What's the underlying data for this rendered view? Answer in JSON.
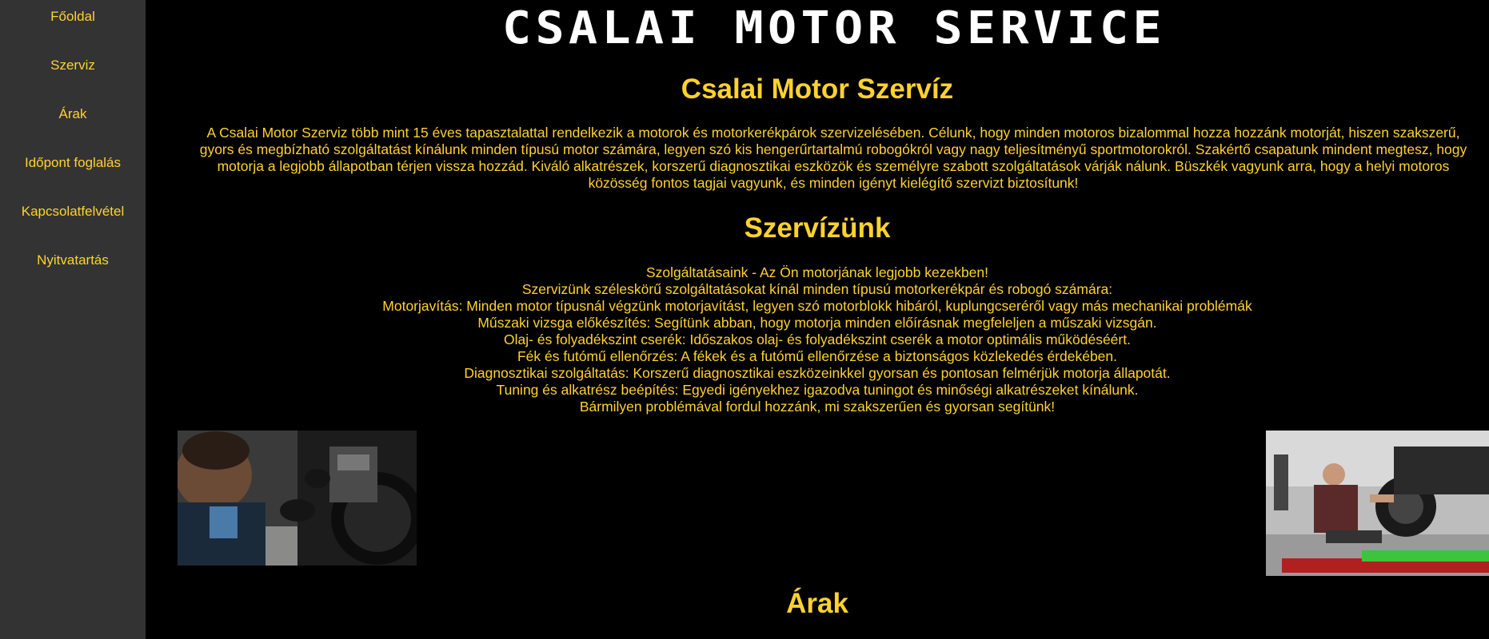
{
  "sidebar": {
    "items": [
      {
        "label": "Főoldal"
      },
      {
        "label": "Szerviz"
      },
      {
        "label": "Árak"
      },
      {
        "label": "Időpont foglalás"
      },
      {
        "label": "Kapcsolatfelvétel"
      },
      {
        "label": "Nyitvatartás"
      }
    ]
  },
  "header": {
    "logo_text": "CSALAI MOTOR SERVICE"
  },
  "main": {
    "title": "Csalai Motor Szervíz",
    "intro_lines": [
      "A Csalai Motor Szerviz több mint 15 éves tapasztalattal rendelkezik a motorok és motorkerékpárok szervizelésében. Célunk, hogy minden motoros bizalommal hozza hozzánk motorját, hiszen szakszerű,",
      "gyors és megbízható szolgáltatást kínálunk minden típusú motor számára, legyen szó kis hengerűrtartalmú robogókról vagy nagy teljesítményű sportmotorokról. Szakértő csapatunk mindent megtesz, hogy",
      "motorja a legjobb állapotban térjen vissza hozzád. Kiváló alkatrészek, korszerű diagnosztikai eszközök és személyre szabott szolgáltatások várják nálunk. Büszkék vagyunk arra, hogy a helyi motoros",
      "közösség fontos tagjai vagyunk, és minden igényt kielégítő szervizt biztosítunk!"
    ],
    "services_heading": "Szervízünk",
    "services_lines": [
      "Szolgáltatásaink - Az Ön motorjának legjobb kezekben!",
      "Szervizünk széleskörű szolgáltatásokat kínál minden típusú motorkerékpár és robogó számára:",
      "Motorjavítás: Minden motor típusnál végzünk motorjavítást, legyen szó motorblokk hibáról, kuplungcseréről vagy más mechanikai problémák",
      "Műszaki vizsga előkészítés: Segítünk abban, hogy motorja minden előírásnak megfeleljen a műszaki vizsgán.",
      "Olaj- és folyadékszint cserék: Időszakos olaj- és folyadékszint cserék a motor optimális működéséért.",
      "Fék és futómű ellenőrzés: A fékek és a futómű ellenőrzése a biztonságos közlekedés érdekében.",
      "Diagnosztikai szolgáltatás: Korszerű diagnosztikai eszközeinkkel gyorsan és pontosan felmérjük motorja állapotát.",
      "Tuning és alkatrész beépítés: Egyedi igényekhez igazodva tuningot és minőségi alkatrészeket kínálunk.",
      "Bármilyen problémával fordul hozzánk, mi szakszerűen és gyorsan segítünk!"
    ],
    "prices_heading": "Árak"
  },
  "colors": {
    "accent": "#ffd22f",
    "sidebar_bg": "#333333",
    "page_bg": "#000000"
  }
}
